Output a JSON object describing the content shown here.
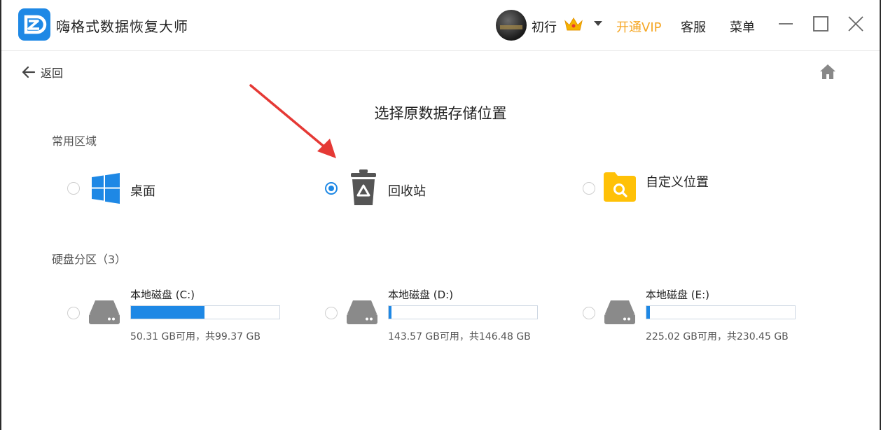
{
  "app": {
    "title": "嗨格式数据恢复大师"
  },
  "header": {
    "username": "初行",
    "vip_label": "开通VIP",
    "service_label": "客服",
    "menu_label": "菜单",
    "icons": [
      "minimize-icon",
      "maximize-icon",
      "close-icon"
    ]
  },
  "nav": {
    "back_label": "返回"
  },
  "main": {
    "title": "选择原数据存储位置",
    "common_section": "常用区域",
    "common_options": [
      {
        "label": "桌面",
        "icon": "windows-icon",
        "selected": false
      },
      {
        "label": "回收站",
        "icon": "recycle-bin-icon",
        "selected": true
      },
      {
        "label": "自定义位置",
        "icon": "folder-search-icon",
        "selected": false
      }
    ],
    "disk_section": "硬盘分区（3）",
    "drives": [
      {
        "name": "本地磁盘 (C:)",
        "info": "50.31 GB可用，共99.37 GB",
        "used_fraction": 0.494
      },
      {
        "name": "本地磁盘 (D:)",
        "info": "143.57 GB可用，共146.48 GB",
        "used_fraction": 0.02
      },
      {
        "name": "本地磁盘 (E:)",
        "info": "225.02 GB可用，共230.45 GB",
        "used_fraction": 0.024
      }
    ]
  },
  "colors": {
    "accent": "#1e88e5",
    "vip": "#f5a623",
    "folder": "#ffc107",
    "arrow": "#e53935"
  }
}
